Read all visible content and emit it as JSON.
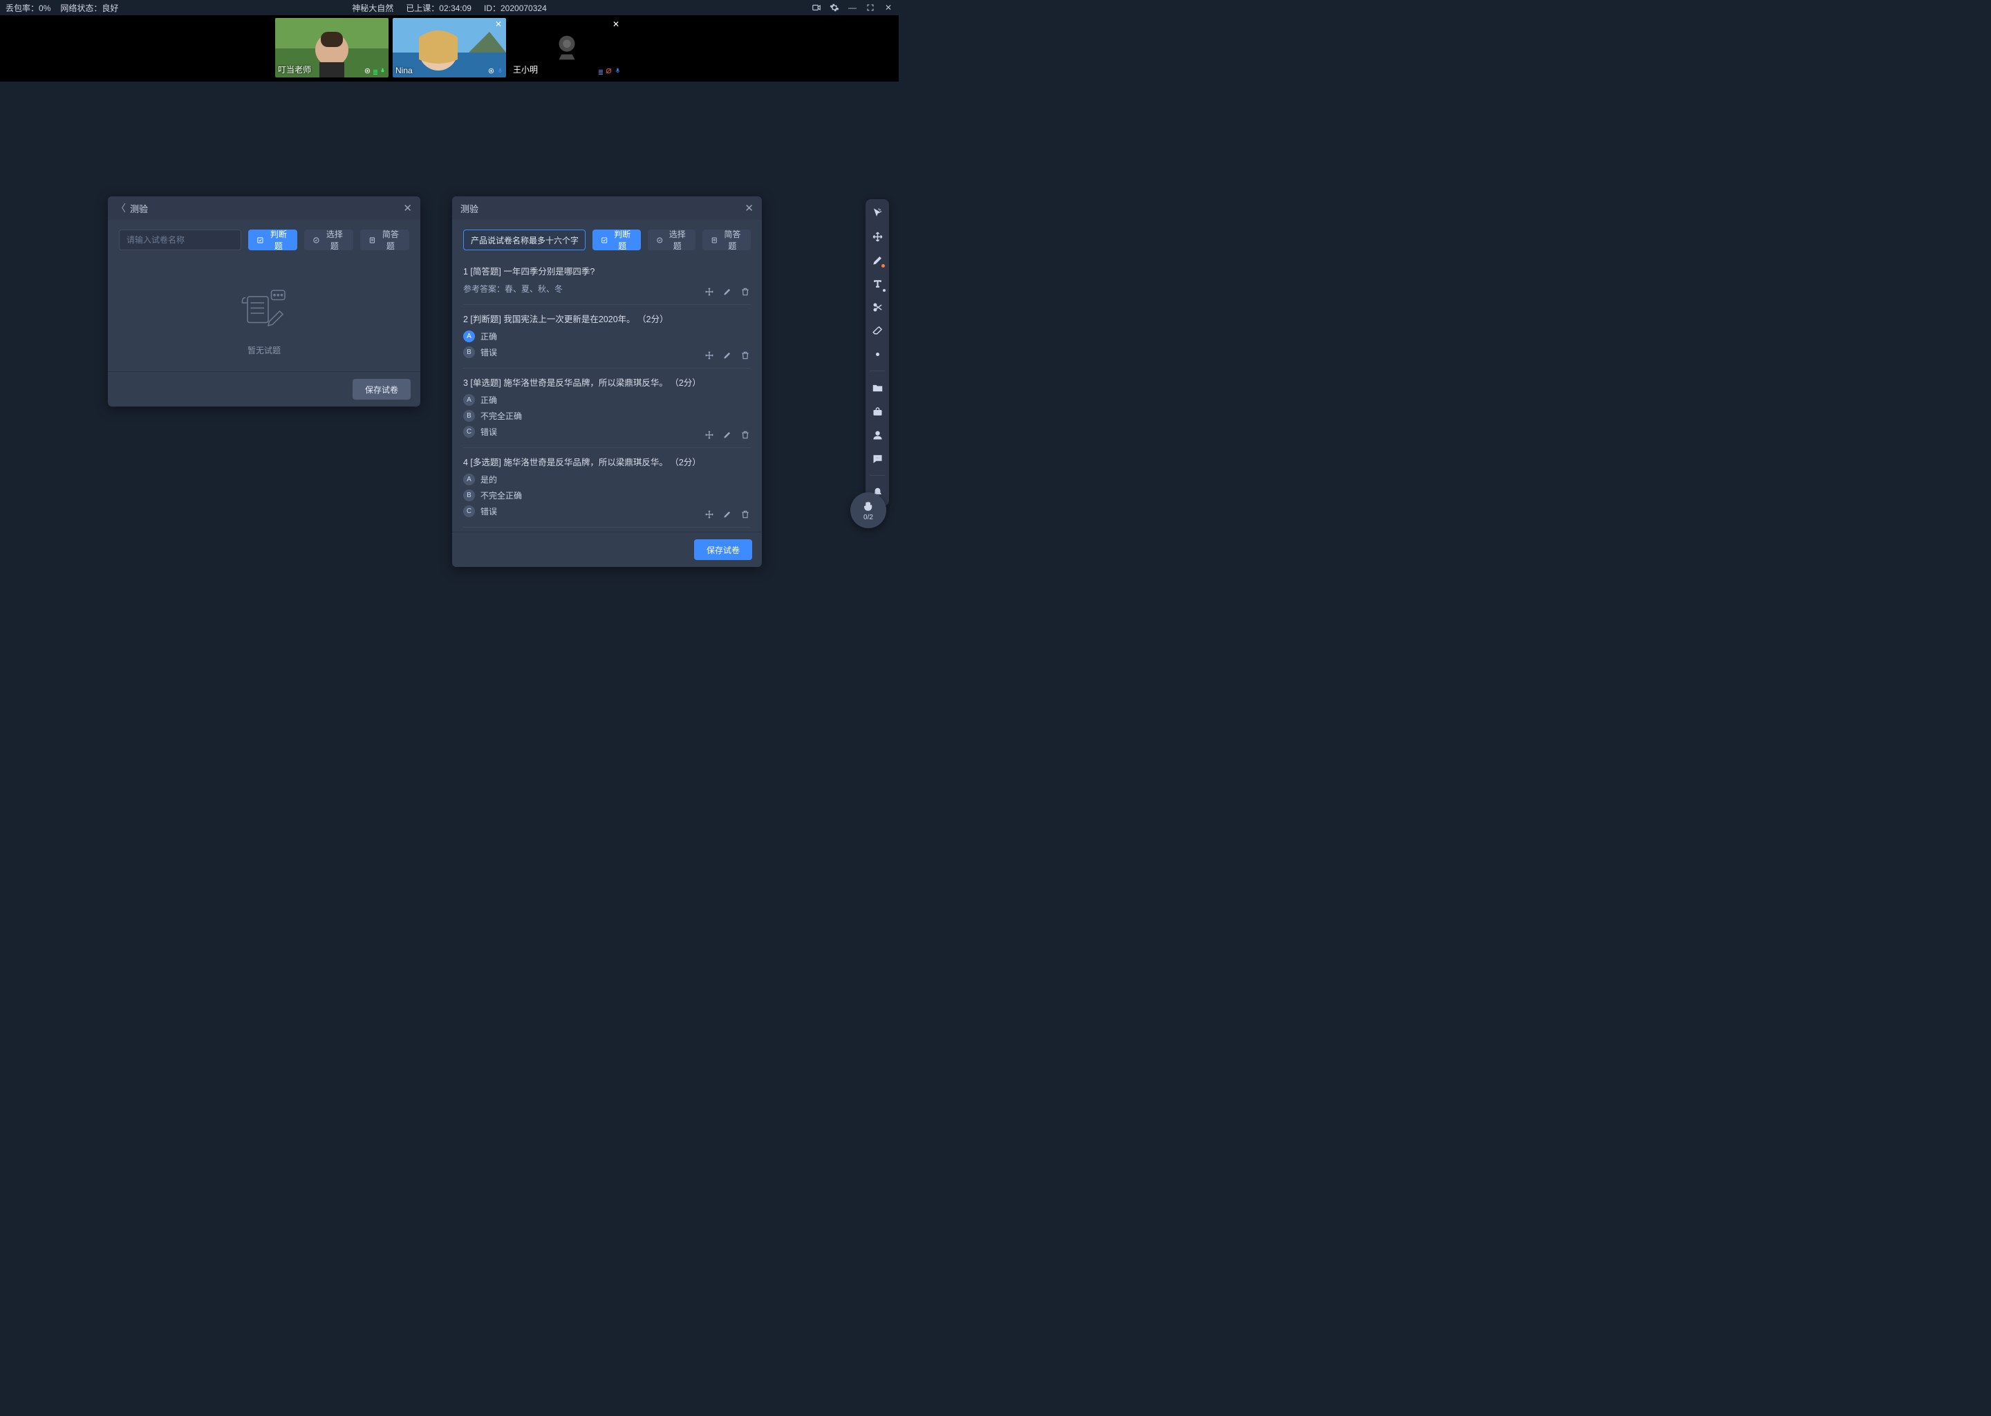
{
  "topbar": {
    "packet_loss_label": "丢包率：",
    "packet_loss_value": "0%",
    "network_label": "网络状态：",
    "network_value": "良好",
    "course_title": "神秘大自然",
    "elapsed_label": "已上课：",
    "elapsed_value": "02:34:09",
    "id_label": "ID：",
    "id_value": "2020070324"
  },
  "videos": [
    {
      "name": "叮当老师",
      "has_close": false,
      "cam_on": true
    },
    {
      "name": "Nina",
      "has_close": true,
      "cam_on": true
    },
    {
      "name": "王小明",
      "has_close": true,
      "cam_on": false
    }
  ],
  "panel_left": {
    "title": "测验",
    "input_placeholder": "请输入试卷名称",
    "btn_judge": "判断题",
    "btn_choice": "选择题",
    "btn_short": "简答题",
    "empty_label": "暂无试题",
    "save_label": "保存试卷"
  },
  "panel_right": {
    "title": "测验",
    "input_value": "产品说试卷名称最多十六个字",
    "btn_judge": "判断题",
    "btn_choice": "选择题",
    "btn_short": "简答题",
    "save_label": "保存试卷",
    "questions": [
      {
        "num": "1",
        "tag": "[简答题]",
        "text": "一年四季分别是哪四季?",
        "answer_label": "参考答案：",
        "answer": "春、夏、秋、冬"
      },
      {
        "num": "2",
        "tag": "[判断题]",
        "text": "我国宪法上一次更新是在2020年。",
        "score": "（2分）",
        "options": [
          {
            "k": "A",
            "t": "正确",
            "sel": true
          },
          {
            "k": "B",
            "t": "错误",
            "sel": false
          }
        ]
      },
      {
        "num": "3",
        "tag": "[单选题]",
        "text": "施华洛世奇是反华品牌，所以梁鼎琪反华。",
        "score": "（2分）",
        "options": [
          {
            "k": "A",
            "t": "正确",
            "sel": false
          },
          {
            "k": "B",
            "t": "不完全正确",
            "sel": false
          },
          {
            "k": "C",
            "t": "错误",
            "sel": false
          }
        ]
      },
      {
        "num": "4",
        "tag": "[多选题]",
        "text": "施华洛世奇是反华品牌，所以梁鼎琪反华。",
        "score": "（2分）",
        "options": [
          {
            "k": "A",
            "t": "是的",
            "sel": false
          },
          {
            "k": "B",
            "t": "不完全正确",
            "sel": false
          },
          {
            "k": "C",
            "t": "错误",
            "sel": false
          }
        ]
      }
    ]
  },
  "hand": {
    "count": "0/2"
  },
  "toolbar_icons": [
    "cursor",
    "move",
    "pen",
    "text",
    "scissors",
    "eraser",
    "dot",
    "folder",
    "toolbox",
    "person",
    "chat",
    "bell"
  ]
}
